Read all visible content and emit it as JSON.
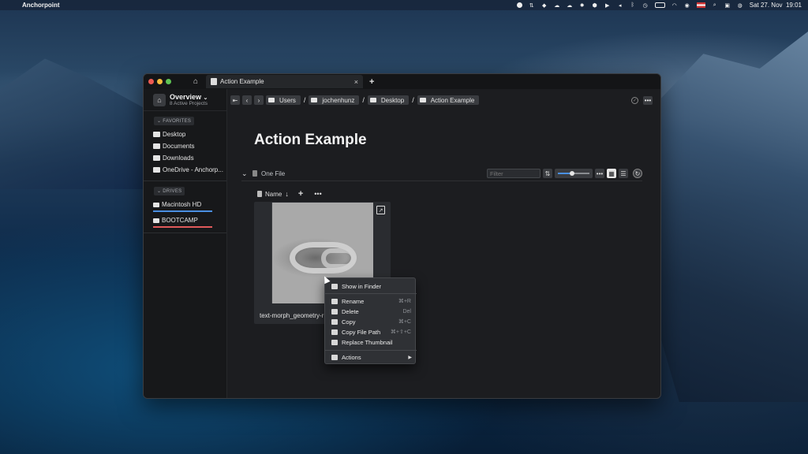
{
  "menubar": {
    "app_name": "Anchorpoint",
    "clock": "Sat 27. Nov  19:01"
  },
  "window": {
    "tab_title": "Action Example",
    "tab_close": "×",
    "add_tab": "+"
  },
  "sidebar": {
    "project_title": "Overview",
    "project_subtitle": "8 Active Projects",
    "favorites_label": "FAVORITES",
    "favorites": [
      {
        "label": "Desktop"
      },
      {
        "label": "Documents"
      },
      {
        "label": "Downloads"
      },
      {
        "label": "OneDrive - Anchorp..."
      }
    ],
    "drives_label": "DRIVES",
    "drives": [
      {
        "label": "Macintosh HD",
        "bar_color": "#4a8fe2"
      },
      {
        "label": "BOOTCAMP",
        "bar_color": "#e05a5a"
      }
    ]
  },
  "toolbar": {
    "breadcrumbs": [
      "Users",
      "jochenhunz",
      "Desktop",
      "Action Example"
    ],
    "separator": "/"
  },
  "main": {
    "title": "Action Example",
    "file_count": "One File",
    "filter_placeholder": "Filter",
    "zoom_level": 0.45,
    "sort_label": "Name",
    "file_name": "text-morph_geometry-r"
  },
  "context_menu": {
    "items": [
      {
        "label": "Show in Finder",
        "shortcut": ""
      },
      {
        "label": "Rename",
        "shortcut": "⌘+R"
      },
      {
        "label": "Delete",
        "shortcut": "Del"
      },
      {
        "label": "Copy",
        "shortcut": "⌘+C"
      },
      {
        "label": "Copy File Path",
        "shortcut": "⌘+⇧+C"
      },
      {
        "label": "Replace Thumbnail",
        "shortcut": ""
      },
      {
        "label": "Actions",
        "shortcut": ""
      }
    ]
  }
}
